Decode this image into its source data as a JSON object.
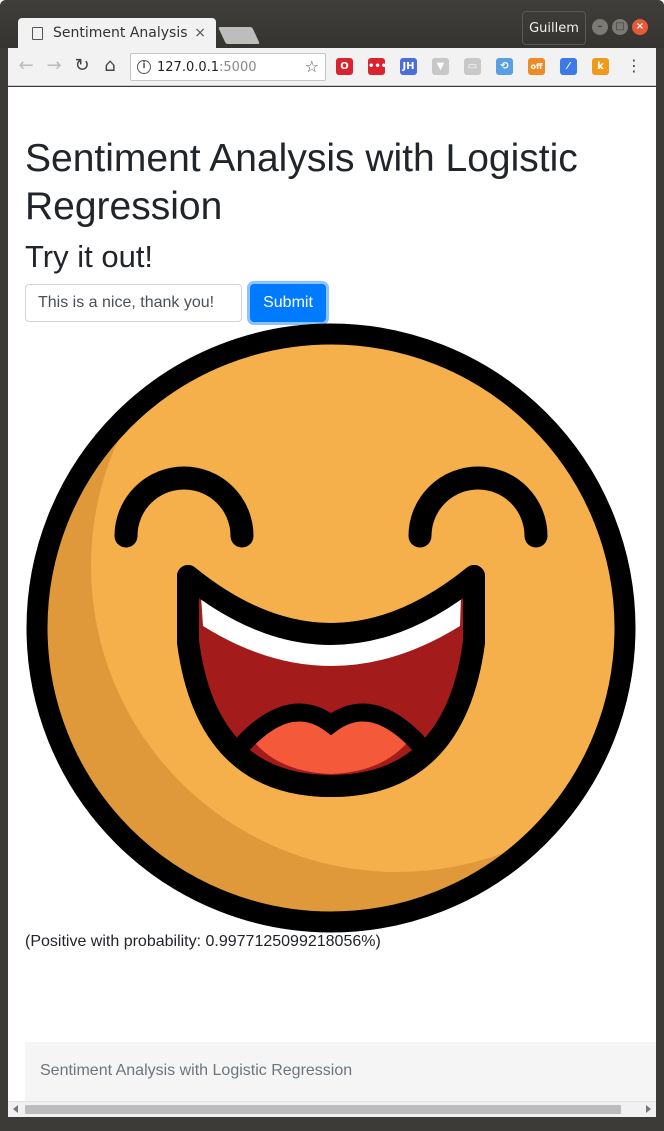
{
  "browser": {
    "tab_title": "Sentiment Analysis",
    "tab_close": "×",
    "profile_name": "Guillem",
    "url_host": "127.0.0.1",
    "url_port": ":5000",
    "nav": {
      "back": "←",
      "forward": "→",
      "reload": "↻",
      "home": "⌂"
    },
    "window_buttons": {
      "minimize": "–",
      "maximize": "□",
      "close": "×"
    },
    "extensions": [
      {
        "name": "opera-icon",
        "color": "#d9232f",
        "text": "O"
      },
      {
        "name": "dots-ext-icon",
        "color": "#d9232f",
        "text": "•••"
      },
      {
        "name": "jh-ext-icon",
        "color": "#4a6fdc",
        "text": "JH"
      },
      {
        "name": "shield-ext-icon",
        "color": "#c8c8c8",
        "text": "▼"
      },
      {
        "name": "chat-ext-icon",
        "color": "#c8c8c8",
        "text": "▭"
      },
      {
        "name": "translate-ext-icon",
        "color": "#5aa0e0",
        "text": "⟲"
      },
      {
        "name": "off-ext-icon",
        "color": "#f08a24",
        "text": "off"
      },
      {
        "name": "eyedropper-ext-icon",
        "color": "#3b7ae8",
        "text": "⁄"
      },
      {
        "name": "k-ext-icon",
        "color": "#f09a1a",
        "text": "k"
      }
    ],
    "menu": "⋮"
  },
  "page": {
    "title": "Sentiment Analysis with Logistic Regression",
    "subtitle": "Try it out!",
    "input_value": "This is a nice, thank you!",
    "submit_label": "Submit",
    "result_text": "(Positive with probability: 0.9977125099218056%)",
    "footer_text": "Sentiment Analysis with Logistic Regression"
  },
  "emoji": {
    "face_color": "#f5b04b",
    "shade_color": "#e0993a",
    "mouth_color": "#a31b1b",
    "tongue_color": "#f45a3a",
    "teeth_color": "#ffffff",
    "outline_color": "#000000"
  },
  "colors": {
    "primary": "#007bff",
    "text": "#212529",
    "muted": "#6c757d"
  }
}
